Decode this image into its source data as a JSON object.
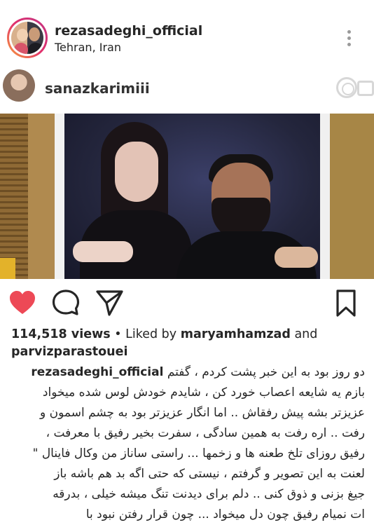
{
  "header": {
    "username": "rezasadeghi_official",
    "location": "Tehran, Iran",
    "more_icon": "more-vertical-icon"
  },
  "post_image": {
    "tagged_username": "sanazkarimiii",
    "igtv_icon": "igtv-icon"
  },
  "actions": {
    "like_icon": "heart-icon",
    "like_color": "#ed4956",
    "comment_icon": "comment-icon",
    "share_icon": "send-icon",
    "save_icon": "bookmark-icon"
  },
  "stats": {
    "views": "114,518 views",
    "separator": " • Liked by ",
    "liked_by_1": "maryamhamzad",
    "and": " and",
    "liked_by_2": "parvizparastouei"
  },
  "caption": {
    "owner": "rezasadeghi_official",
    "lines": [
      "دو روز بود به این خبر پشت کردم ، گفتم",
      "بازم یه شایعه اعصاب خورد کن ، شایدم خودش لوس شده میخواد",
      "عزیزتر بشه پیش رفقاش .. اما انگار عزیزتر بود به چشم اسمون و",
      "رفت .. اره رفت به همین سادگی ، سفرت بخیر رفیق با معرفت ،",
      "رفیق روزای تلخ طعنه ها و زخمها ... راستی ساناز من وکال فاینال \"",
      "لعنت به این تصویر و گرفتم ، نیستی که حتی اگه بد هم باشه باز",
      "جیغ بزنی و ذوق کنی .. دلم برای دیدنت تنگ میشه خیلی ، بدرقه",
      "ات نمیام رفیق چون دل میخواد ... چون قرار رفتن نبود با"
    ]
  }
}
